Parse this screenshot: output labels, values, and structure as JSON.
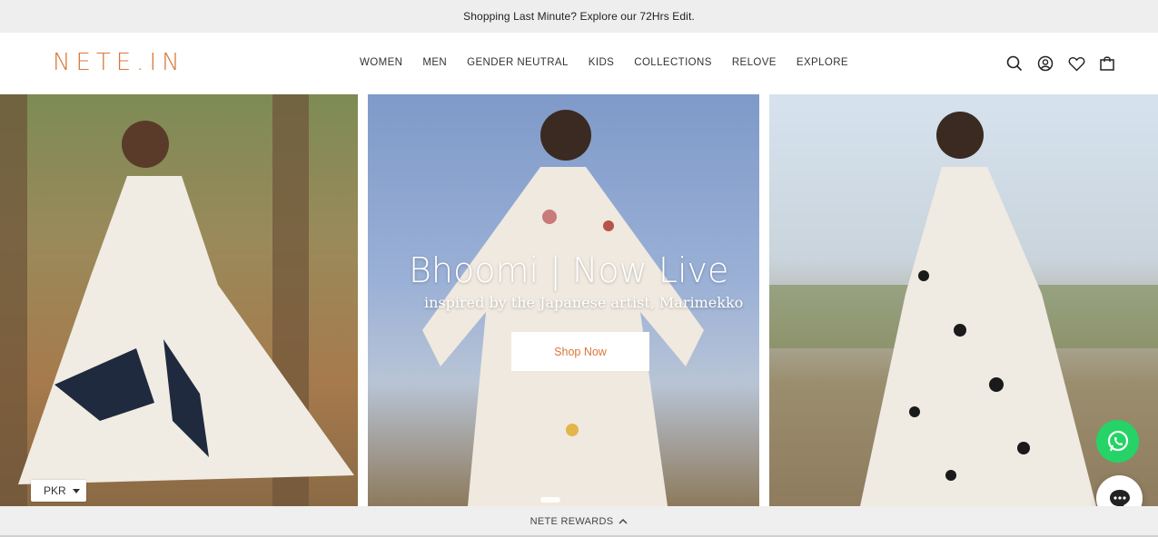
{
  "announcement": "Shopping Last Minute? Explore our 72Hrs Edit.",
  "brand": {
    "logo": "NETE.IN",
    "accent_color": "#d9773a"
  },
  "nav": {
    "items": [
      "WOMEN",
      "MEN",
      "GENDER NEUTRAL",
      "KIDS",
      "COLLECTIONS",
      "RELOVE",
      "EXPLORE"
    ]
  },
  "header_icons": [
    "search-icon",
    "account-icon",
    "wishlist-heart-icon",
    "shopping-bag-icon"
  ],
  "hero": {
    "title": "Bhoomi | Now Live",
    "subtitle": "inspired by the Japanese artist, Marimekko",
    "cta": "Shop Now"
  },
  "currency": {
    "selected": "PKR"
  },
  "rewards": {
    "label": "NETE REWARDS"
  },
  "colors": {
    "whatsapp": "#25d366",
    "bar_bg": "#efeeef"
  }
}
